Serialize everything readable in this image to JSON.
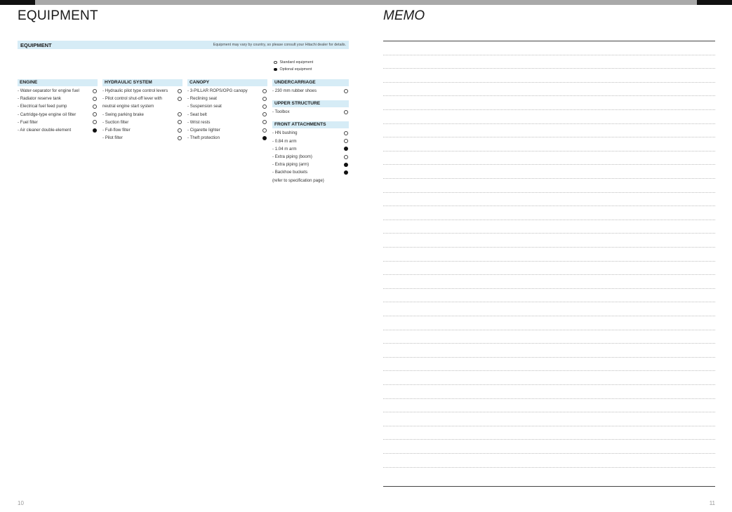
{
  "header": {
    "left_title": "EQUIPMENT",
    "right_title": "MEMO"
  },
  "banner": {
    "title": "EQUIPMENT",
    "note": "Equipment may vary by country, so please consult your Hitachi dealer for details."
  },
  "legend": {
    "standard": "Standard equipment",
    "optional": "Optional equipment"
  },
  "columns": [
    {
      "sections": [
        {
          "title": "ENGINE",
          "items": [
            {
              "label": "- Water-separator for engine fuel",
              "type": "standard"
            },
            {
              "label": "- Radiator reserve tank",
              "type": "standard"
            },
            {
              "label": "- Electrical fuel feed pump",
              "type": "standard"
            },
            {
              "label": "- Cartridge-type engine oil filter",
              "type": "standard"
            },
            {
              "label": "- Fuel filter",
              "type": "standard"
            },
            {
              "label": "- Air cleaner double-element",
              "type": "optional"
            }
          ]
        }
      ]
    },
    {
      "sections": [
        {
          "title": "HYDRAULIC SYSTEM",
          "items": [
            {
              "label": "- Hydraulic pilot type control levers",
              "type": "standard"
            },
            {
              "label": "- Pilot control shut-off lever with\n  neutral engine start system",
              "type": "standard"
            },
            {
              "label": "- Swing parking brake",
              "type": "standard"
            },
            {
              "label": "- Suction filter",
              "type": "standard"
            },
            {
              "label": "- Full-flow filter",
              "type": "standard"
            },
            {
              "label": "- Pilot filter",
              "type": "standard"
            }
          ]
        }
      ]
    },
    {
      "sections": [
        {
          "title": "CANOPY",
          "items": [
            {
              "label": "- 3-PILLAR ROPS/OPG canopy",
              "type": "standard"
            },
            {
              "label": "- Reclining seat",
              "type": "standard"
            },
            {
              "label": "- Suspension seat",
              "type": "standard"
            },
            {
              "label": "- Seat belt",
              "type": "standard"
            },
            {
              "label": "- Wrist rests",
              "type": "standard"
            },
            {
              "label": "- Cigarette lighter",
              "type": "standard"
            },
            {
              "label": "- Theft protection",
              "type": "optional"
            }
          ]
        }
      ]
    },
    {
      "sections": [
        {
          "title": "UNDERCARRIAGE",
          "items": [
            {
              "label": "- 230 mm rubber shoes",
              "type": "standard"
            }
          ]
        },
        {
          "title": "UPPER STRUCTURE",
          "items": [
            {
              "label": "- Toolbox",
              "type": "standard"
            }
          ]
        },
        {
          "title": "FRONT ATTACHMENTS",
          "items": [
            {
              "label": "- HN bushing",
              "type": "standard"
            },
            {
              "label": "- 0.84 m arm",
              "type": "standard"
            },
            {
              "label": "- 1.04 m arm",
              "type": "optional"
            },
            {
              "label": "- Extra piping (boom)",
              "type": "standard"
            },
            {
              "label": "- Extra piping (arm)",
              "type": "optional"
            },
            {
              "label": "- Backhoe buckets\n  (refer to specification page)",
              "type": "optional"
            }
          ]
        }
      ]
    }
  ],
  "footer": {
    "left_page": "10",
    "right_page": "11"
  }
}
